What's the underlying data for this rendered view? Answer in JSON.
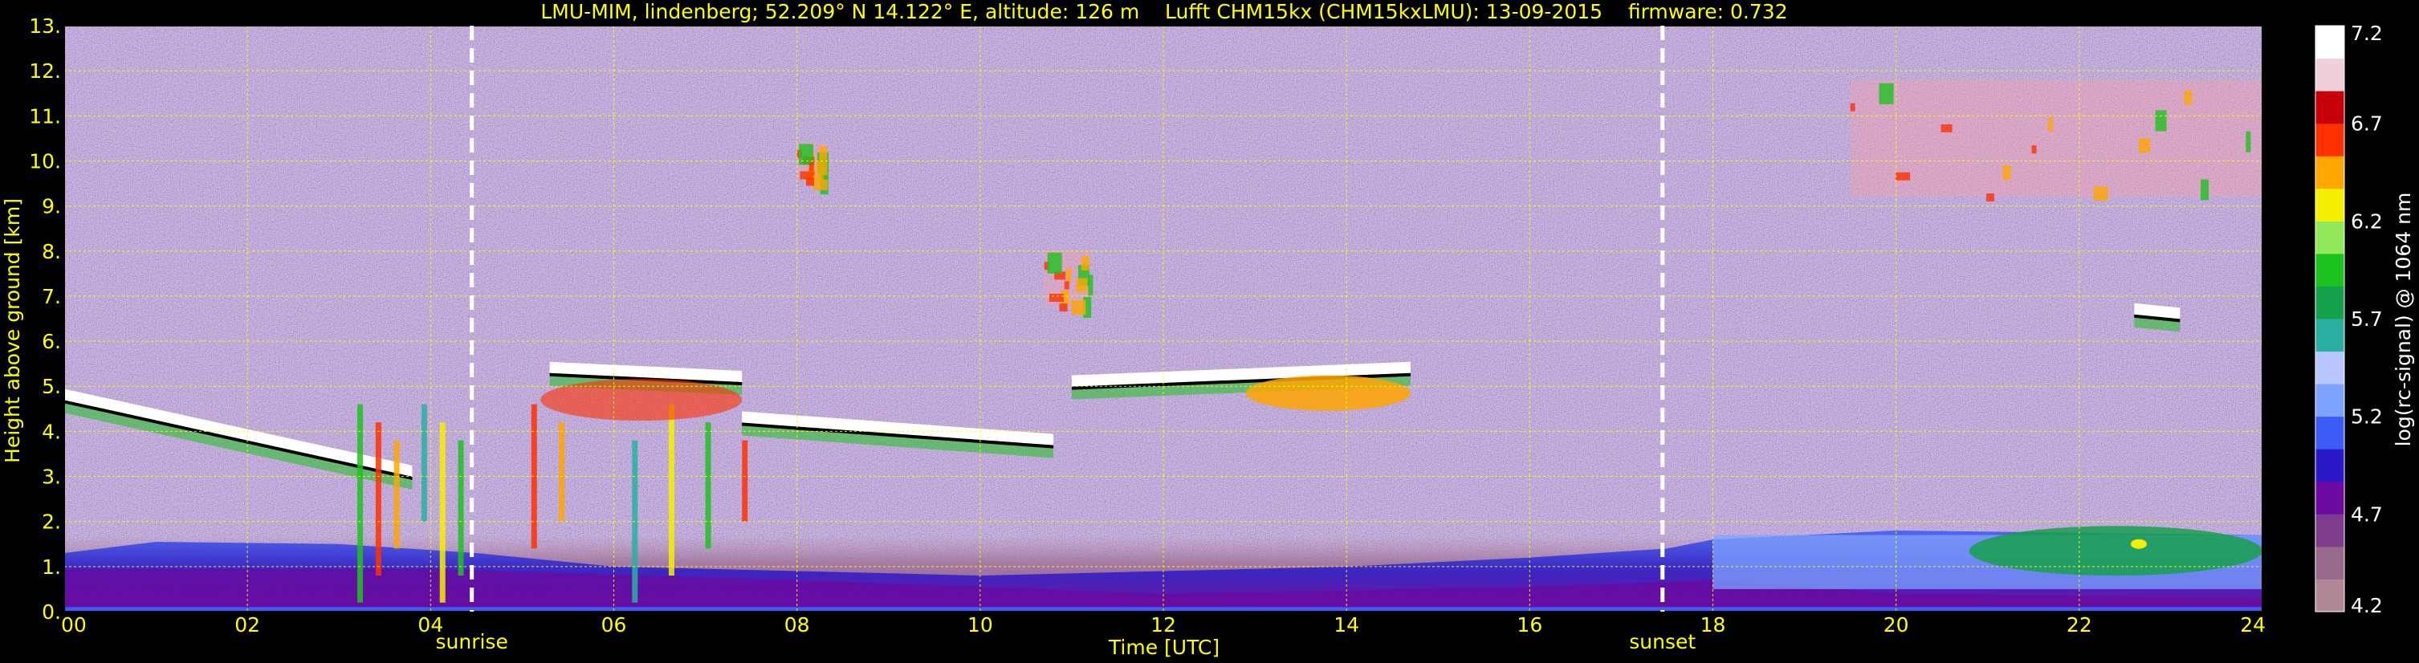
{
  "chart_data": {
    "type": "heatmap",
    "title": "LMU-MIM, lindenberg; 52.209° N 14.122° E, altitude: 126 m    Lufft CHM15kx (CHM15kxLMU): 13-09-2015    firmware: 0.732",
    "xlabel": "Time [UTC]",
    "ylabel": "Height above ground [km]",
    "colorbar_label": "log(rc-signal) @ 1064 nm",
    "xlim": [
      0,
      24
    ],
    "ylim": [
      0,
      13
    ],
    "x_ticks": [
      "00",
      "02",
      "04",
      "06",
      "08",
      "10",
      "12",
      "14",
      "16",
      "18",
      "20",
      "22",
      "24"
    ],
    "y_ticks": [
      "0.",
      "1.",
      "2.",
      "3.",
      "4.",
      "5.",
      "6.",
      "7.",
      "8.",
      "9.",
      "10.",
      "11.",
      "12.",
      "13."
    ],
    "colorbar_ticks": [
      "4.2",
      "4.7",
      "5.2",
      "5.7",
      "6.2",
      "6.7",
      "7.2"
    ],
    "colorbar_range": [
      4.2,
      7.2
    ],
    "colorbar_colors": [
      "#b08898",
      "#9a6a8e",
      "#7d3c8c",
      "#6a0aa0",
      "#2a18c8",
      "#3b5cf5",
      "#7fa4ff",
      "#b8c6ff",
      "#2ab0a0",
      "#17a04c",
      "#1ec21e",
      "#90e85a",
      "#f5f000",
      "#ffa600",
      "#ff3000",
      "#c8000a",
      "#f0d0d8",
      "#ffffff"
    ],
    "grid": true,
    "events": [
      {
        "label": "sunrise",
        "time": 4.45
      },
      {
        "label": "sunset",
        "time": 17.45
      }
    ],
    "features": {
      "cloud_base_layers_km": [
        {
          "from": 0.0,
          "to": 3.8,
          "height": [
            4.8,
            3.1
          ]
        },
        {
          "from": 5.3,
          "to": 7.4,
          "height": [
            5.4,
            5.2
          ]
        },
        {
          "from": 7.4,
          "to": 10.8,
          "height": [
            4.3,
            3.8
          ]
        },
        {
          "from": 11.0,
          "to": 14.7,
          "height": [
            5.1,
            5.4
          ]
        },
        {
          "from": 22.6,
          "to": 23.1,
          "height": [
            6.7,
            6.6
          ]
        }
      ],
      "boundary_layer_top_km": [
        {
          "from": 0.0,
          "to": 24.0,
          "height": [
            1.7,
            1.8
          ]
        }
      ],
      "cirrus_km": [
        {
          "from": 8.0,
          "to": 8.3,
          "height": [
            9.6,
            10.4
          ]
        },
        {
          "from": 10.7,
          "to": 11.2,
          "height": [
            6.8,
            8.0
          ]
        },
        {
          "from": 19.5,
          "to": 24.0,
          "height": [
            9.2,
            11.8
          ]
        }
      ]
    }
  }
}
